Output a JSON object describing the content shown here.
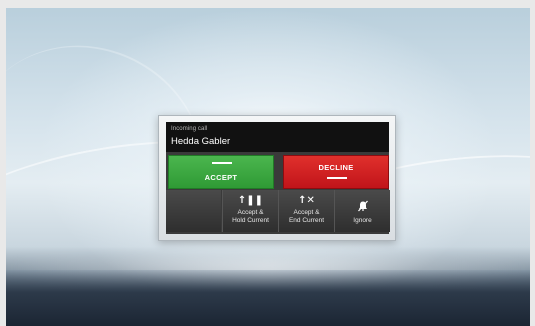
{
  "incoming_call": {
    "subtitle": "Incoming call",
    "caller_name": "Hedda Gabler"
  },
  "actions": {
    "accept_label": "ACCEPT",
    "decline_label": "DECLINE",
    "accept_hold_label_line1": "Accept &",
    "accept_hold_label_line2": "Hold Current",
    "accept_end_label_line1": "Accept &",
    "accept_end_label_line2": "End Current",
    "ignore_label": "Ignore"
  },
  "icons": {
    "accept_hold": "arrow-up-pause-icon",
    "accept_end": "arrow-up-x-icon",
    "ignore": "muted-bell-icon"
  },
  "colors": {
    "accept": "#3aa83f",
    "decline": "#d42024",
    "header": "#111111"
  }
}
